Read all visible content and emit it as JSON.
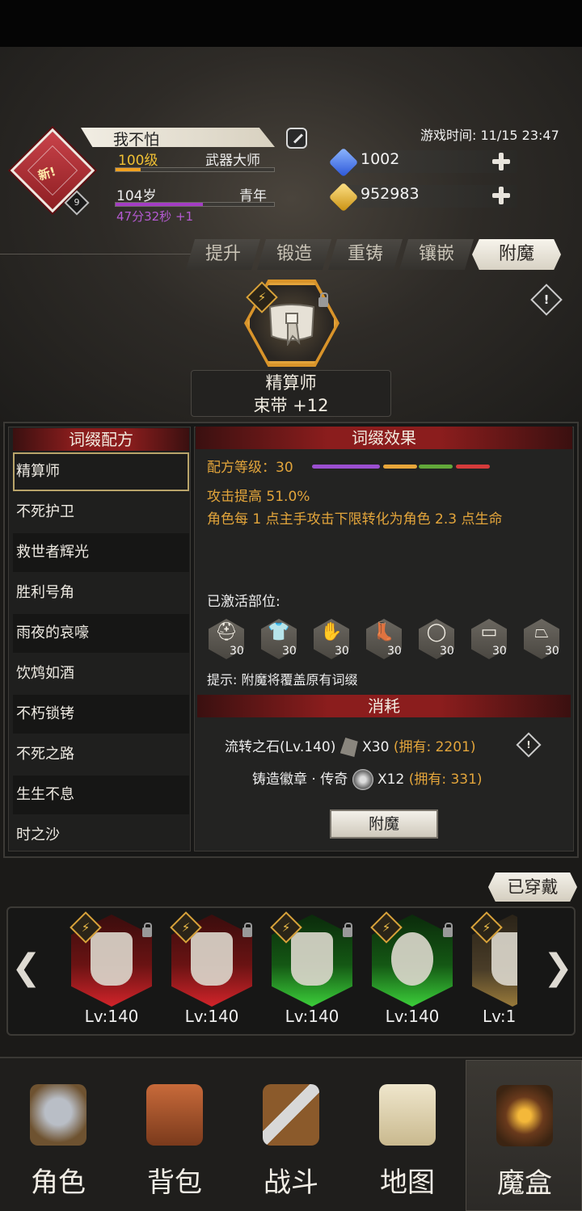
{
  "header": {
    "player_name": "我不怕",
    "level": "100级",
    "title": "武器大师",
    "age": "104岁",
    "life_stage": "青年",
    "timer": "47分32秒  +1",
    "avatar_badge": "新!",
    "avatar_level": "9",
    "game_time": "游戏时间: 11/15 23:47",
    "level_progress": 0.16,
    "age_progress": 0.55
  },
  "currency": {
    "gems": "1002",
    "gold": "952983",
    "gem_color": "#3a6ff0",
    "gold_color": "#e2b21e"
  },
  "tabs": [
    {
      "label": "提升"
    },
    {
      "label": "锻造"
    },
    {
      "label": "重铸"
    },
    {
      "label": "镶嵌"
    },
    {
      "label": "附魔"
    }
  ],
  "active_tab": "附魔",
  "item": {
    "affix": "精算师",
    "name": "束带 +12"
  },
  "recipes": {
    "header": "词缀配方",
    "items": [
      "精算师",
      "不死护卫",
      "救世者辉光",
      "胜利号角",
      "雨夜的哀嚎",
      "饮鸩如酒",
      "不朽锁铐",
      "不死之路",
      "生生不息",
      "时之沙"
    ]
  },
  "effects": {
    "header": "词缀效果",
    "recipe_level": "配方等级：30",
    "line1": "攻击提高 51.0%",
    "line2": "角色每 1 点主手攻击下限转化为角色 2.3 点生命",
    "activated_label": "已激活部位:",
    "slots": [
      {
        "icon": "helmet-icon",
        "glyph": "⛑",
        "level": "30"
      },
      {
        "icon": "chest-armor-icon",
        "glyph": "👕",
        "level": "30"
      },
      {
        "icon": "glove-icon",
        "glyph": "✋",
        "level": "30"
      },
      {
        "icon": "boots-icon",
        "glyph": "👢",
        "level": "30"
      },
      {
        "icon": "ring-icon",
        "glyph": "◯",
        "level": "30"
      },
      {
        "icon": "belt-icon",
        "glyph": "▭",
        "level": "30"
      },
      {
        "icon": "skirt-icon",
        "glyph": "⏢",
        "level": "30"
      }
    ],
    "hint": "提示: 附魔将覆盖原有词缀"
  },
  "cost": {
    "header": "消耗",
    "item1_name": "流转之石(Lv.140)",
    "item1_qty": "X30",
    "item1_own": "(拥有: 2201)",
    "item2_name": "铸造徽章 · 传奇",
    "item2_qty": "X12",
    "item2_own": "(拥有: 331)",
    "button": "附魔"
  },
  "equipped": {
    "label": "已穿戴",
    "items": [
      {
        "level": "Lv:140",
        "rarity": "red"
      },
      {
        "level": "Lv:140",
        "rarity": "red"
      },
      {
        "level": "Lv:140",
        "rarity": "green"
      },
      {
        "level": "Lv:140",
        "rarity": "green"
      },
      {
        "level": "Lv:1",
        "rarity": "gold"
      }
    ]
  },
  "nav": [
    {
      "label": "角色"
    },
    {
      "label": "背包"
    },
    {
      "label": "战斗"
    },
    {
      "label": "地图"
    },
    {
      "label": "魔盒"
    }
  ],
  "active_nav": "魔盒"
}
